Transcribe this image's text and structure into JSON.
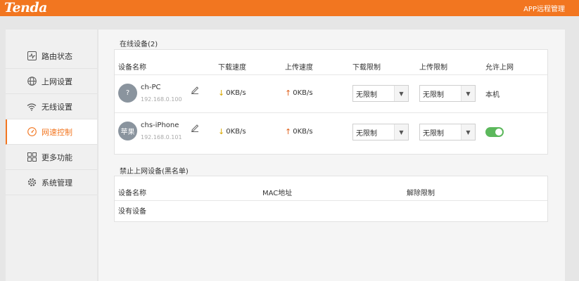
{
  "header": {
    "logo": "Tenda",
    "app_link": "APP远程管理"
  },
  "sidebar": {
    "items": [
      {
        "label": "路由状态",
        "icon": "pulse-icon"
      },
      {
        "label": "上网设置",
        "icon": "globe-icon"
      },
      {
        "label": "无线设置",
        "icon": "wifi-icon"
      },
      {
        "label": "网速控制",
        "icon": "speedometer-icon",
        "active": true
      },
      {
        "label": "更多功能",
        "icon": "grid-icon"
      },
      {
        "label": "系统管理",
        "icon": "gear-icon"
      }
    ]
  },
  "online": {
    "title": "在线设备(2)",
    "headers": {
      "name": "设备名称",
      "download": "下载速度",
      "upload": "上传速度",
      "dl_limit": "下载限制",
      "ul_limit": "上传限制",
      "allow": "允许上网"
    },
    "devices": [
      {
        "avatar": "?",
        "name": "ch-PC",
        "ip": "192.168.0.100",
        "download": "0KB/s",
        "upload": "0KB/s",
        "dl_limit": "无限制",
        "ul_limit": "无限制",
        "allow": "本机"
      },
      {
        "avatar": "苹果",
        "name": "chs-iPhone",
        "ip": "192.168.0.101",
        "download": "0KB/s",
        "upload": "0KB/s",
        "dl_limit": "无限制",
        "ul_limit": "无限制",
        "allow_enabled": true
      }
    ]
  },
  "blacklist": {
    "title": "禁止上网设备(黑名单)",
    "headers": {
      "name": "设备名称",
      "mac": "MAC地址",
      "remove": "解除限制"
    },
    "empty": "没有设备"
  },
  "colors": {
    "accent": "#f27620",
    "toggle_on": "#5cb85c"
  }
}
